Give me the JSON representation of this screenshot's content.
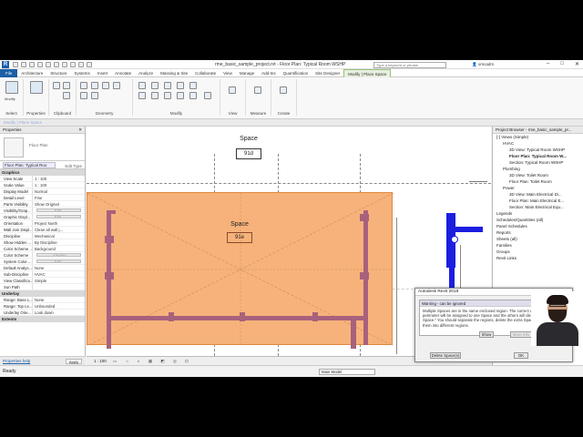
{
  "app": {
    "title": "rme_basic_sample_project.rvt - Floor Plan: Typical Room WSHP",
    "logo": "R",
    "search_placeholder": "Type a keyword or phrase",
    "user": "omcadm",
    "window_controls": [
      "–",
      "□",
      "✕"
    ]
  },
  "tabs": [
    "File",
    "Architecture",
    "Structure",
    "Systems",
    "Insert",
    "Annotate",
    "Analyze",
    "Massing & Site",
    "Collaborate",
    "View",
    "Manage",
    "Add-Ins",
    "Quantification",
    "Site Designer",
    "Modify | Place Space"
  ],
  "active_tab": "Modify | Place Space",
  "ribbon": {
    "modify_label": "Modify",
    "groups": [
      "Select",
      "Properties",
      "Clipboard",
      "Geometry",
      "Modify",
      "View",
      "Measure",
      "Create"
    ]
  },
  "context_bar": "Modify | Place Space",
  "properties": {
    "header": "Properties",
    "close": "✕",
    "type_name": "Floor Plan",
    "selector": "Floor Plan: Typical Roo",
    "edit_type": "Edit Type",
    "sections": [
      {
        "name": "Graphics",
        "rows": [
          {
            "k": "View Scale",
            "v": "1 : 100"
          },
          {
            "k": "Scale Value",
            "v": "1 : 100"
          },
          {
            "k": "Display Model",
            "v": "Normal"
          },
          {
            "k": "Detail Level",
            "v": "Fine"
          },
          {
            "k": "Parts Visibility",
            "v": "Show Original"
          },
          {
            "k": "Visibility/Grap...",
            "v": "Edit...",
            "btn": true
          },
          {
            "k": "Graphic Displ...",
            "v": "Edit...",
            "btn": true
          },
          {
            "k": "Orientation",
            "v": "Project North"
          },
          {
            "k": "Wall Join Displ...",
            "v": "Clean all wall j..."
          },
          {
            "k": "Discipline",
            "v": "Mechanical"
          },
          {
            "k": "Show Hidden ...",
            "v": "By Discipline"
          },
          {
            "k": "Color Scheme ...",
            "v": "Background"
          },
          {
            "k": "Color Scheme",
            "v": "<none>",
            "btn": true
          },
          {
            "k": "System Color ...",
            "v": "Edit...",
            "btn": true
          },
          {
            "k": "Default Analys...",
            "v": "None"
          },
          {
            "k": "Sub-Discipline",
            "v": "HVAC"
          },
          {
            "k": "View Classifica...",
            "v": "Simple"
          },
          {
            "k": "Sun Path",
            "v": ""
          }
        ]
      },
      {
        "name": "Underlay",
        "rows": [
          {
            "k": "Range: Base L...",
            "v": "None"
          },
          {
            "k": "Range: Top Le...",
            "v": "Unbounded"
          },
          {
            "k": "Underlay Orie...",
            "v": "Look down"
          }
        ]
      },
      {
        "name": "Extents",
        "rows": []
      }
    ],
    "help_link": "Properties help",
    "apply": "Apply"
  },
  "canvas": {
    "space_top_label": "Space",
    "space_top_tag": "91d",
    "space_main_label": "Space",
    "space_main_tag": "91e",
    "view_scale": "1 : 100"
  },
  "browser": {
    "header": "Project Browser - rme_basic_sample_pr...",
    "items": [
      {
        "t": "[-] Views (Simple)",
        "d": 0
      },
      {
        "t": "HVAC",
        "d": 1
      },
      {
        "t": "3D View: Typical Room WSHP",
        "d": 2
      },
      {
        "t": "Floor Plan: Typical Room W...",
        "d": 2,
        "b": true
      },
      {
        "t": "Section: Typical Room WSHP",
        "d": 2
      },
      {
        "t": "Plumbing",
        "d": 1
      },
      {
        "t": "3D View: Toilet Room",
        "d": 2
      },
      {
        "t": "Floor Plan: Toilet Room",
        "d": 2
      },
      {
        "t": "Power",
        "d": 1
      },
      {
        "t": "3D View: Main Electrical Di...",
        "d": 2
      },
      {
        "t": "Floor Plan: Main Electrical E...",
        "d": 2
      },
      {
        "t": "Section: Main Electrical Equ...",
        "d": 2
      },
      {
        "t": "Legends",
        "d": 0
      },
      {
        "t": "Schedules/Quantities (all)",
        "d": 0
      },
      {
        "t": "Panel Schedules",
        "d": 0
      },
      {
        "t": "Reports",
        "d": 0
      },
      {
        "t": "Sheets (all)",
        "d": 0
      },
      {
        "t": "Families",
        "d": 0
      },
      {
        "t": "Groups",
        "d": 0
      },
      {
        "t": "Revit Links",
        "d": 0
      }
    ]
  },
  "dialog": {
    "title": "Autodesk Revit 2018",
    "warning": "Warning - can be ignored",
    "message": "Multiple Spaces are in the same enclosed region. The correct area and perimeter will be assigned to one Space and the others will display \"Redundant Space.\" You should separate the regions, delete the extra Spaces, or move them into different regions.",
    "show": "Show",
    "more_info": "More Info",
    "expand": "Expand >>",
    "delete": "Delete Space(s)",
    "ok": "OK"
  },
  "status": {
    "text": "Ready",
    "model": "Main Model"
  }
}
